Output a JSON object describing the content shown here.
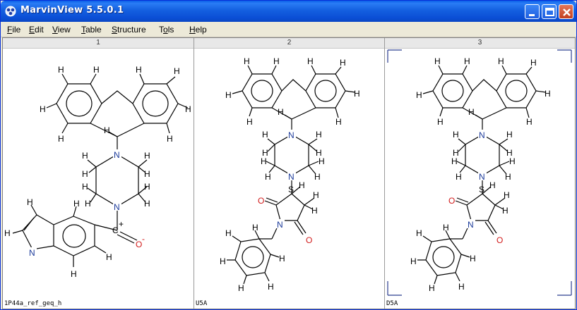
{
  "window": {
    "title": "MarvinView 5.5.0.1",
    "app_icon": "marvin-icon",
    "controls": [
      "minimize-icon",
      "maximize-icon",
      "close-icon"
    ]
  },
  "menu": [
    {
      "label": "File",
      "u": "F",
      "rest": "ile"
    },
    {
      "label": "Edit",
      "u": "E",
      "rest": "dit"
    },
    {
      "label": "View",
      "u": "V",
      "rest": "iew"
    },
    {
      "label": "Table",
      "u": "T",
      "rest": "able"
    },
    {
      "label": "Structure",
      "u": "S",
      "rest": "tructure"
    },
    {
      "label": "Tools",
      "u": "o",
      "pre": "T",
      "rest": "ls"
    },
    {
      "label": "Help",
      "u": "H",
      "rest": "elp"
    }
  ],
  "cells": [
    {
      "index": "1",
      "name": "1P44a_ref_geq_h"
    },
    {
      "index": "2",
      "name": "U5A"
    },
    {
      "index": "3",
      "name": "D5A"
    }
  ],
  "atoms": {
    "H": "H",
    "N": "N",
    "O": "O",
    "C": "C",
    "charge_plus": "+",
    "charge_minus": "-",
    "stereo_S": "S"
  },
  "colors": {
    "title_blue": "#0b4fd6",
    "nitrogen": "#1b3a9a",
    "oxygen": "#d11a1a",
    "selection_bracket": "#2b3d8f"
  }
}
